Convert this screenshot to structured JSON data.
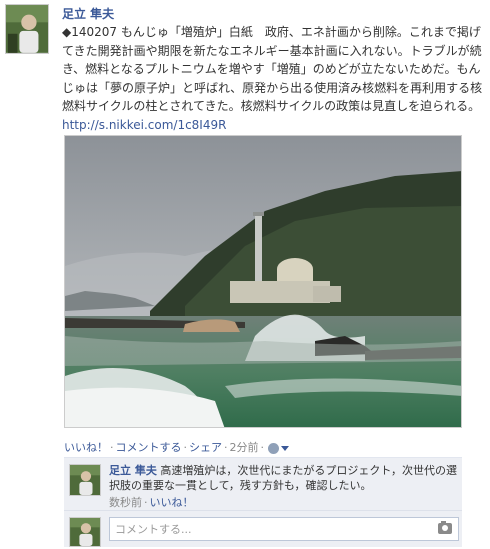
{
  "post": {
    "author": "足立 隼夫",
    "text": "◆140207 もんじゅ「増殖炉」白紙　政府、エネ計画から削除。これまで掲げてきた開発計画や期限を新たなエネルギー基本計画に入れない。トラブルが続き、燃料となるプルトニウムを増やす「増殖」のめどが立たないためだ。もんじゅは「夢の原子炉」と呼ばれ、原発から出る使用済み核燃料を再利用する核燃料サイクルの柱とされてきた。核燃料サイクルの政策は見直しを迫られる。",
    "link": "http://s.nikkei.com/1c8I49R"
  },
  "actions": {
    "like": "いいね！",
    "comment": "コメントする",
    "share": "シェア",
    "time": "2分前",
    "separator": "·"
  },
  "comment": {
    "author": "足立 隼夫",
    "text": "高速増殖炉は，次世代にまたがるプロジェクト，次世代の選択肢の重要な一貫として，残す方針も，確認したい。",
    "time": "数秒前",
    "like": "いいね！",
    "separator": "·"
  },
  "composer": {
    "placeholder": "コメントする..."
  },
  "icons": {
    "privacy": "globe-icon",
    "camera": "camera-icon",
    "dropdown": "chevron-down-icon"
  },
  "colors": {
    "link": "#3b5998",
    "comments_bg": "#edeff4",
    "meta": "#888888"
  }
}
